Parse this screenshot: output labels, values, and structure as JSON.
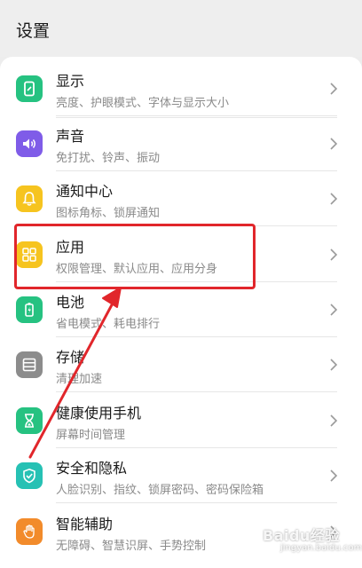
{
  "header": {
    "title": "设置"
  },
  "items": [
    {
      "title": "显示",
      "subtitle": "亮度、护眼模式、字体与显示大小",
      "icon": "display-icon",
      "color": "#26c281"
    },
    {
      "title": "声音",
      "subtitle": "免打扰、铃声、振动",
      "icon": "sound-icon",
      "color": "#7f5ce8"
    },
    {
      "title": "通知中心",
      "subtitle": "图标角标、锁屏通知",
      "icon": "bell-icon",
      "color": "#f6c41f"
    },
    {
      "title": "应用",
      "subtitle": "权限管理、默认应用、应用分身",
      "icon": "apps-icon",
      "color": "#f6c41f"
    },
    {
      "title": "电池",
      "subtitle": "省电模式、耗电排行",
      "icon": "battery-icon",
      "color": "#26c281"
    },
    {
      "title": "存储",
      "subtitle": "清理加速",
      "icon": "storage-icon",
      "color": "#8c8c8c"
    },
    {
      "title": "健康使用手机",
      "subtitle": "屏幕时间管理",
      "icon": "hourglass-icon",
      "color": "#26c281"
    },
    {
      "title": "安全和隐私",
      "subtitle": "人脸识别、指纹、锁屏密码、密码保险箱",
      "icon": "shield-icon",
      "color": "#26c1b4"
    },
    {
      "title": "智能辅助",
      "subtitle": "无障碍、智慧识屏、手势控制",
      "icon": "hand-icon",
      "color": "#f28b2b"
    }
  ],
  "annotation": {
    "color": "#e1262b"
  },
  "watermark": {
    "text": "Baidu经验",
    "sub": "jingyan.baidu.com"
  }
}
